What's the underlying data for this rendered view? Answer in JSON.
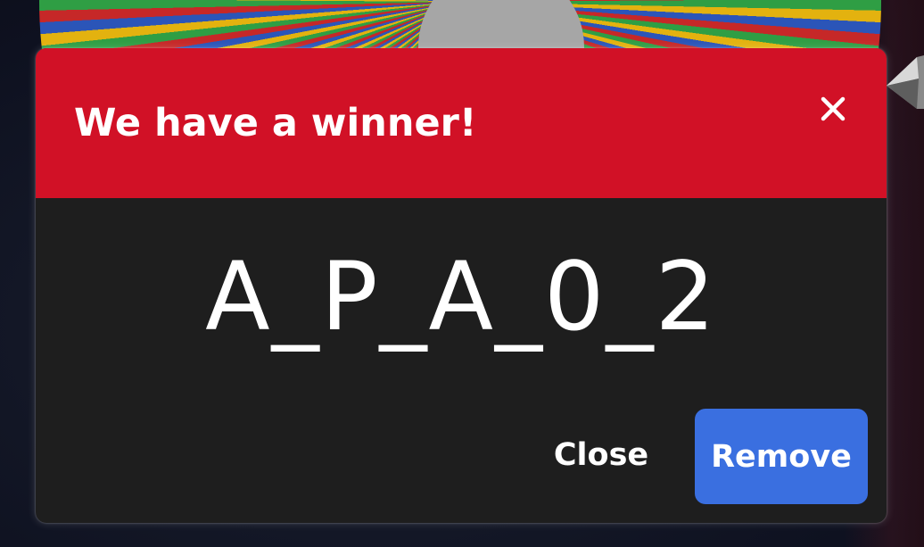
{
  "dialog": {
    "title": "We have a winner!",
    "winner": "A_P_A_0_2",
    "close_icon": "close-icon",
    "buttons": {
      "close_label": "Close",
      "remove_label": "Remove"
    }
  },
  "colors": {
    "header_red": "#d11126",
    "dialog_body": "#1e1e1e",
    "primary_blue": "#3a6fe0",
    "text": "#ffffff"
  }
}
